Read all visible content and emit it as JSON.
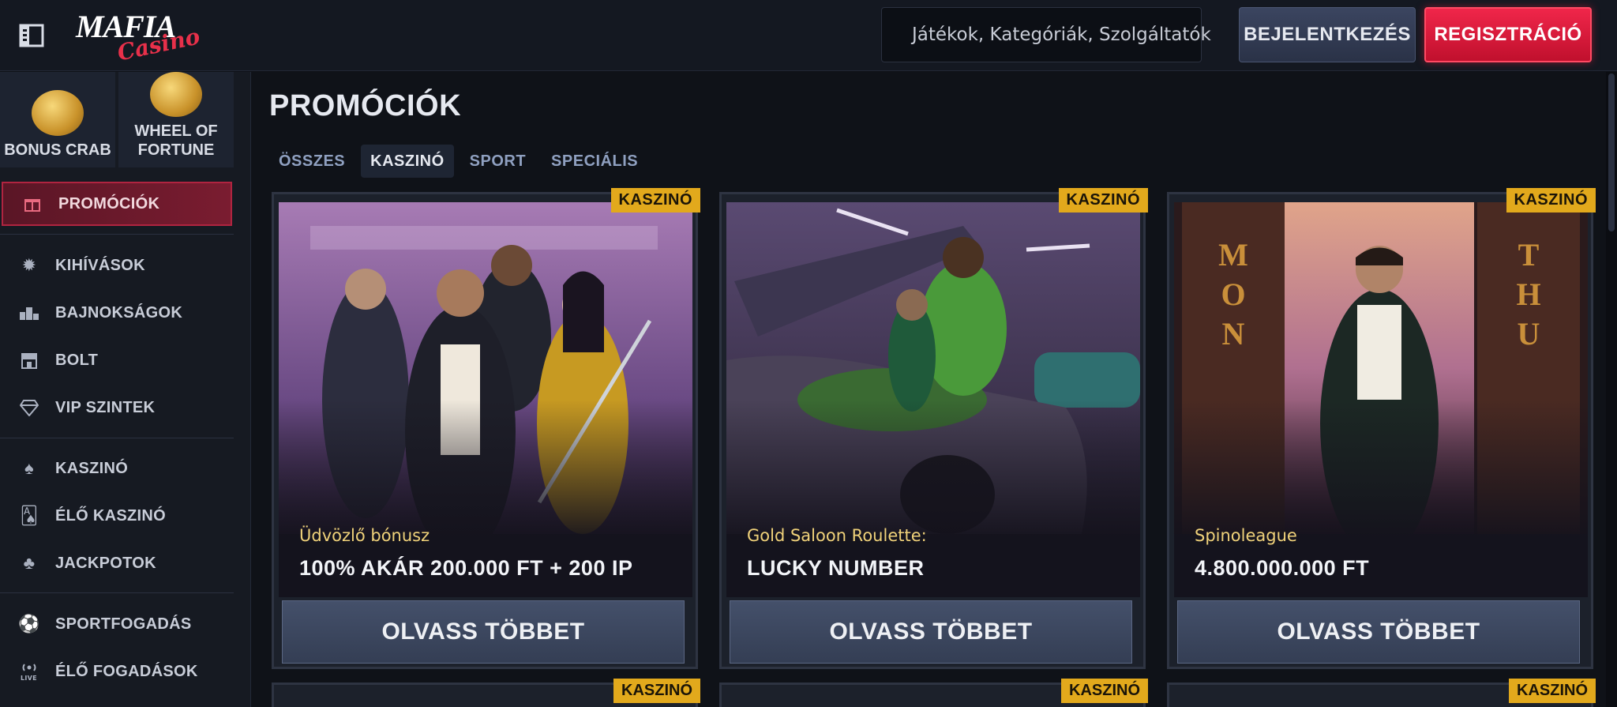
{
  "header": {
    "logo_line1": "MAFIA",
    "logo_line2": "Casino",
    "search_placeholder": "Játékok, Kategóriák, Szolgáltatók",
    "login_label": "BEJELENTKEZÉS",
    "register_label": "REGISZTRÁCIÓ"
  },
  "sidebar": {
    "tiles": [
      {
        "label": "BONUS CRAB",
        "icon": "crab-icon"
      },
      {
        "label": "WHEEL OF FORTUNE",
        "icon": "wheel-icon"
      }
    ],
    "items": [
      {
        "label": "PROMÓCIÓK",
        "icon": "gift-icon",
        "active": true
      },
      {
        "label": "KIHÍVÁSOK",
        "icon": "gear-icon"
      },
      {
        "label": "BAJNOKSÁGOK",
        "icon": "podium-icon"
      },
      {
        "label": "BOLT",
        "icon": "shop-icon"
      },
      {
        "label": "VIP SZINTEK",
        "icon": "diamond-icon"
      },
      {
        "label": "KASZINÓ",
        "icon": "spade-icon"
      },
      {
        "label": "ÉLŐ KASZINÓ",
        "icon": "cards-icon"
      },
      {
        "label": "JACKPOTOK",
        "icon": "clover-icon"
      },
      {
        "label": "SPORTFOGADÁS",
        "icon": "football-icon"
      },
      {
        "label": "ÉLŐ FOGADÁSOK",
        "icon": "live-icon"
      }
    ]
  },
  "main": {
    "title": "PROMÓCIÓK",
    "tabs": [
      {
        "label": "ÖSSZES"
      },
      {
        "label": "KASZINÓ",
        "active": true
      },
      {
        "label": "SPORT"
      },
      {
        "label": "SPECIÁLIS"
      }
    ],
    "cards": [
      {
        "badge": "KASZINÓ",
        "subtitle": "Üdvözlő bónusz",
        "headline": "100% AKÁR 200.000 FT + 200 IP",
        "button": "OLVASS TÖBBET"
      },
      {
        "badge": "KASZINÓ",
        "subtitle": "Gold Saloon Roulette:",
        "headline": "LUCKY NUMBER",
        "button": "OLVASS TÖBBET"
      },
      {
        "badge": "KASZINÓ",
        "subtitle": "Spinoleague",
        "headline": "4.800.000.000 FT",
        "button": "OLVASS TÖBBET"
      }
    ],
    "next_row_badges": [
      "KASZINÓ",
      "KASZINÓ",
      "KASZINÓ"
    ]
  }
}
